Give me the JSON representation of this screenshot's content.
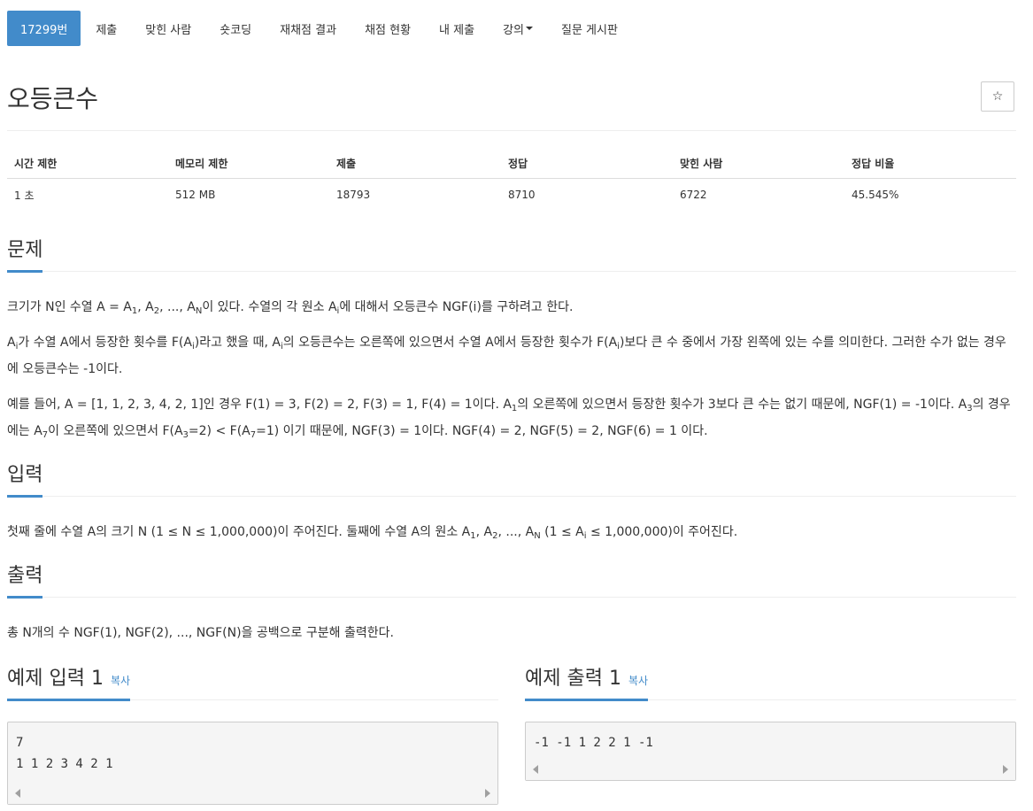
{
  "tabs": [
    {
      "label": "17299번",
      "active": true
    },
    {
      "label": "제출"
    },
    {
      "label": "맞힌 사람"
    },
    {
      "label": "숏코딩"
    },
    {
      "label": "재채점 결과"
    },
    {
      "label": "채점 현황"
    },
    {
      "label": "내 제출"
    },
    {
      "label": "강의"
    },
    {
      "label": "질문 게시판"
    }
  ],
  "title": "오등큰수",
  "star_icon": "☆",
  "info": {
    "headers": [
      "시간 제한",
      "메모리 제한",
      "제출",
      "정답",
      "맞힌 사람",
      "정답 비율"
    ],
    "values": [
      "1 초",
      "512 MB",
      "18793",
      "8710",
      "6722",
      "45.545%"
    ]
  },
  "problem": {
    "heading": "문제",
    "p1": {
      "a": "크기가 N인 수열 A = A",
      "s1": "1",
      "b": ", A",
      "s2": "2",
      "c": ", ..., A",
      "s3": "N",
      "d": "이 있다. 수열의 각 원소 A",
      "s4": "i",
      "e": "에 대해서 오등큰수 NGF(i)를 구하려고 한다."
    },
    "p2": {
      "a": "A",
      "s1": "i",
      "b": "가 수열 A에서 등장한 횟수를 F(A",
      "s2": "i",
      "c": ")라고 했을 때, A",
      "s3": "i",
      "d": "의 오등큰수는 오른쪽에 있으면서 수열 A에서 등장한 횟수가 F(A",
      "s4": "i",
      "e": ")보다 큰 수 중에서 가장 왼쪽에 있는 수를 의미한다. 그러한 수가 없는 경우에 오등큰수는 -1이다."
    },
    "p3": {
      "a": "예를 들어, A = [1, 1, 2, 3, 4, 2, 1]인 경우 F(1) = 3, F(2) = 2, F(3) = 1, F(4) = 1이다. A",
      "s1": "1",
      "b": "의 오른쪽에 있으면서 등장한 횟수가 3보다 큰 수는 없기 때문에, NGF(1) = -1이다. A",
      "s2": "3",
      "c": "의 경우에는 A",
      "s3": "7",
      "d": "이 오른쪽에 있으면서 F(A",
      "s4": "3",
      "e": "=2) < F(A",
      "s5": "7",
      "f": "=1) 이기 때문에, NGF(3) = 1이다. NGF(4) = 2, NGF(5) = 2, NGF(6) = 1 이다."
    }
  },
  "input_section": {
    "heading": "입력",
    "p": {
      "a": "첫째 줄에 수열 A의 크기 N (1 ≤ N ≤ 1,000,000)이 주어진다. 둘째에 수열 A의 원소 A",
      "s1": "1",
      "b": ", A",
      "s2": "2",
      "c": ", ..., A",
      "s3": "N",
      "d": " (1 ≤ A",
      "s4": "i",
      "e": " ≤ 1,000,000)이 주어진다."
    }
  },
  "output_section": {
    "heading": "출력",
    "p": "총 N개의 수 NGF(1), NGF(2), ..., NGF(N)을 공백으로 구분해 출력한다."
  },
  "sample_input": {
    "heading": "예제 입력 1",
    "copy_label": "복사",
    "code": "7\n1 1 2 3 4 2 1"
  },
  "sample_output": {
    "heading": "예제 출력 1",
    "copy_label": "복사",
    "code": "-1 -1 1 2 2 1 -1"
  },
  "colors": {
    "accent": "#428bca",
    "text": "#333333",
    "sample_bg": "#f5f5f5"
  }
}
